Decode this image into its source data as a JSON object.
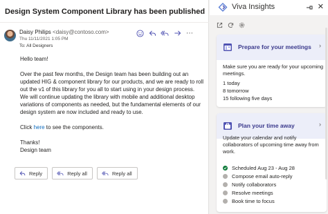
{
  "email": {
    "subject": "Design System Component Library has been published",
    "sender_name": "Daisy Philips",
    "sender_email": "<daisy@contoso.com>",
    "timestamp": "Thu 11/11/2021 1:05 PM",
    "to": "To: All Designers",
    "greeting": "Hello team!",
    "paragraph": "Over the past few months, the Design team has been building out an updated HIG & component library for our products, and we are ready to roll out the v1 of this library for you all to start using in your design process. We will continue updating the library with mobile and additional desktop variations of components as needed, but the fundamental elements of our design system are now included and ready to use.",
    "click_pre": "Click ",
    "click_link": "here",
    "click_post": " to see the components.",
    "thanks": "Thanks!",
    "signature": "Design team",
    "reply_label": "Reply",
    "reply_all_label": "Reply all",
    "reply_all_label_2": "Reply all"
  },
  "viva": {
    "title": "Viva Insights",
    "card1": {
      "title": "Prepare for your meetings",
      "desc": "Make sure you are ready for your upcoming meetings.",
      "stat1": "1 today",
      "stat2": "8 tomorrow",
      "stat3": "15 following five days"
    },
    "card2": {
      "title": "Plan your time away",
      "desc": "Update your calendar and notify collaborators of upcoming time away from work.",
      "steps": [
        "Scheduled Aug 23 - Aug 28",
        "Compose email auto-reply",
        "Notify collaborators",
        "Resolve meetings",
        "Book time to focus"
      ]
    }
  },
  "colors": {
    "accent": "#4f52b2",
    "card_header": "#eceef9",
    "success": "#0e7a3a"
  },
  "icons": [
    "smile-icon",
    "reply-icon",
    "reply-all-icon",
    "forward-icon",
    "more-icon",
    "viva-logo-icon",
    "pin-icon",
    "close-icon",
    "open-external-icon",
    "refresh-icon",
    "settings-icon",
    "calendar-icon",
    "suitcase-icon"
  ]
}
